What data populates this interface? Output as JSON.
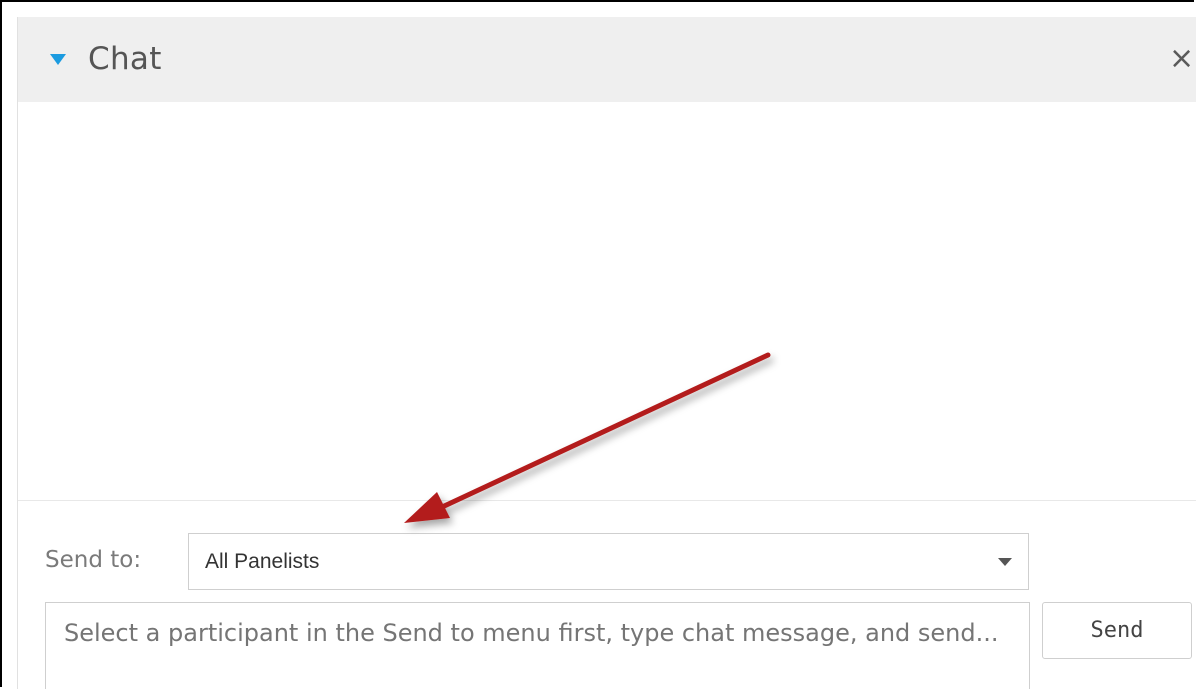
{
  "header": {
    "title": "Chat",
    "close_glyph": "×",
    "collapse_icon": "triangle-down-icon",
    "accent_color": "#1b9be0"
  },
  "compose": {
    "send_to_label": "Send to:",
    "send_to_selected": "All Panelists",
    "message_placeholder": "Select a participant in the Send to menu first, type chat message, and send...",
    "send_label": "Send"
  },
  "annotation": {
    "arrow_color": "#b31b1b"
  }
}
